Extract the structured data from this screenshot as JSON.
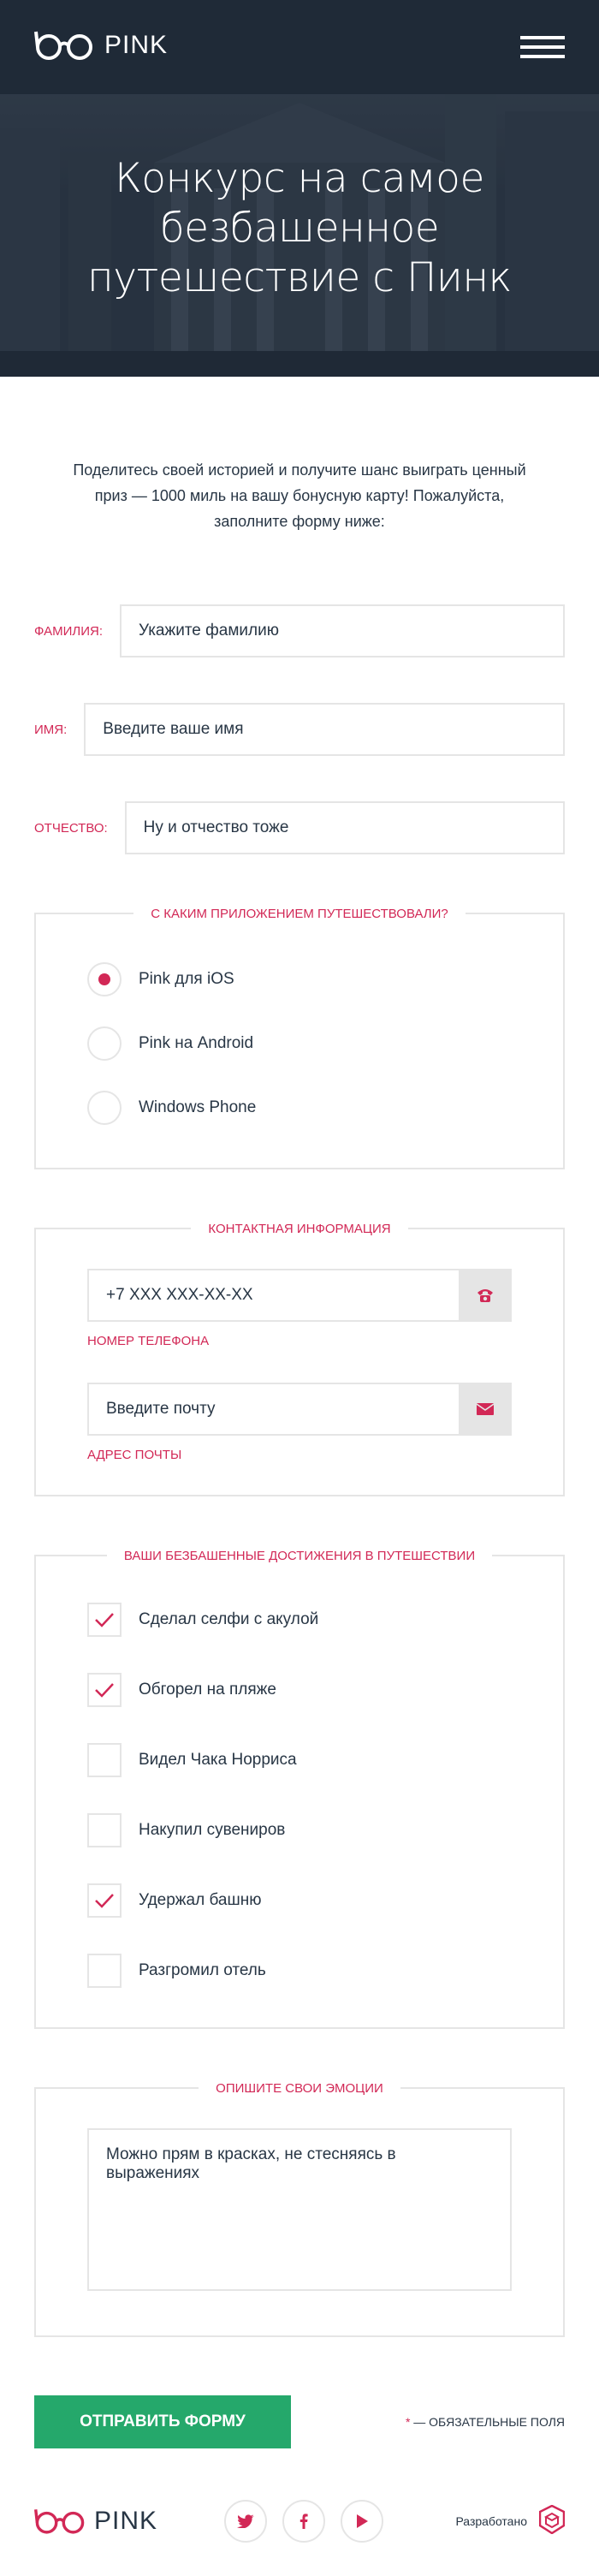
{
  "header": {
    "logo_text": "PINK",
    "title": "Конкурс на самое безбашенное путешествие с Пинк"
  },
  "intro": {
    "text": "Поделитесь своей историей и получите шанс выиграть ценный приз — 1000 миль на вашу бонусную карту! Пожалуйста, заполните форму ниже:"
  },
  "fields": {
    "surname": {
      "label": "ФАМИЛИЯ:",
      "placeholder": "Укажите фамилию"
    },
    "name": {
      "label": "ИМЯ:",
      "placeholder": "Введите ваше имя"
    },
    "patronymic": {
      "label": "ОТЧЕСТВО:",
      "placeholder": "Ну и отчество тоже"
    }
  },
  "app_group": {
    "legend": "С КАКИМ ПРИЛОЖЕНИЕМ ПУТЕШЕСТВОВАЛИ?",
    "options": [
      {
        "label": "Pink для iOS",
        "selected": true
      },
      {
        "label": "Pink на Android",
        "selected": false
      },
      {
        "label": "Windows Phone",
        "selected": false
      }
    ]
  },
  "contact_group": {
    "legend": "КОНТАКТНАЯ ИНФОРМАЦИЯ",
    "phone": {
      "placeholder": "+7 XXX XXX-XX-XX",
      "hint": "НОМЕР ТЕЛЕФОНА",
      "icon": "phone-icon"
    },
    "email": {
      "placeholder": "Введите почту",
      "hint": "АДРЕС ПОЧТЫ",
      "icon": "mail-icon"
    }
  },
  "achievements_group": {
    "legend": "ВАШИ БЕЗБАШЕННЫЕ ДОСТИЖЕНИЯ В ПУТЕШЕСТВИИ",
    "items": [
      {
        "label": "Сделал селфи с акулой",
        "checked": true
      },
      {
        "label": "Обгорел на пляже",
        "checked": true
      },
      {
        "label": "Видел Чака Норриса",
        "checked": false
      },
      {
        "label": "Накупил сувениров",
        "checked": false
      },
      {
        "label": "Удержал башню",
        "checked": true
      },
      {
        "label": "Разгромил отель",
        "checked": false
      }
    ]
  },
  "emotions_group": {
    "legend": "ОПИШИТЕ СВОИ ЭМОЦИИ",
    "placeholder": "Можно прям в красках, не стесняясь в выражениях"
  },
  "submit": {
    "label": "ОТПРАВИТЬ ФОРМУ",
    "required_star": "*",
    "required_note": " — ОБЯЗАТЕЛЬНЫЕ ПОЛЯ"
  },
  "footer": {
    "logo_text": "PINK",
    "socials": [
      "twitter-icon",
      "facebook-icon",
      "youtube-icon"
    ],
    "dev_label": "Разработано"
  },
  "colors": {
    "accent": "#d22856",
    "dark": "#283645",
    "border": "#e5e5e5",
    "submit": "#25a86b",
    "header": "#1f2a37"
  }
}
